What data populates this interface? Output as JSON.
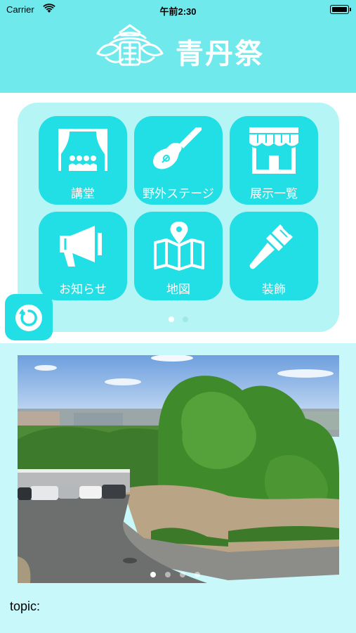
{
  "status_bar": {
    "carrier": "Carrier",
    "time": "午前2:30"
  },
  "header": {
    "title": "青丹祭"
  },
  "menu": {
    "tiles": [
      {
        "label": "講堂",
        "icon": "auditorium-icon"
      },
      {
        "label": "野外ステージ",
        "icon": "guitar-icon"
      },
      {
        "label": "展示一覧",
        "icon": "shop-icon"
      },
      {
        "label": "お知らせ",
        "icon": "megaphone-icon"
      },
      {
        "label": "地図",
        "icon": "map-icon"
      },
      {
        "label": "装飾",
        "icon": "paintbrush-icon"
      }
    ],
    "pages": 2,
    "current_page": 1
  },
  "refresh": {
    "icon": "refresh-icon"
  },
  "photo": {
    "slides": 4,
    "current_slide": 1
  },
  "topic": {
    "label": "topic:"
  },
  "colors": {
    "header": "#6fe9ec",
    "tile": "#22dee5",
    "panel": "#b6f5f6",
    "background": "#c8f8f9"
  }
}
